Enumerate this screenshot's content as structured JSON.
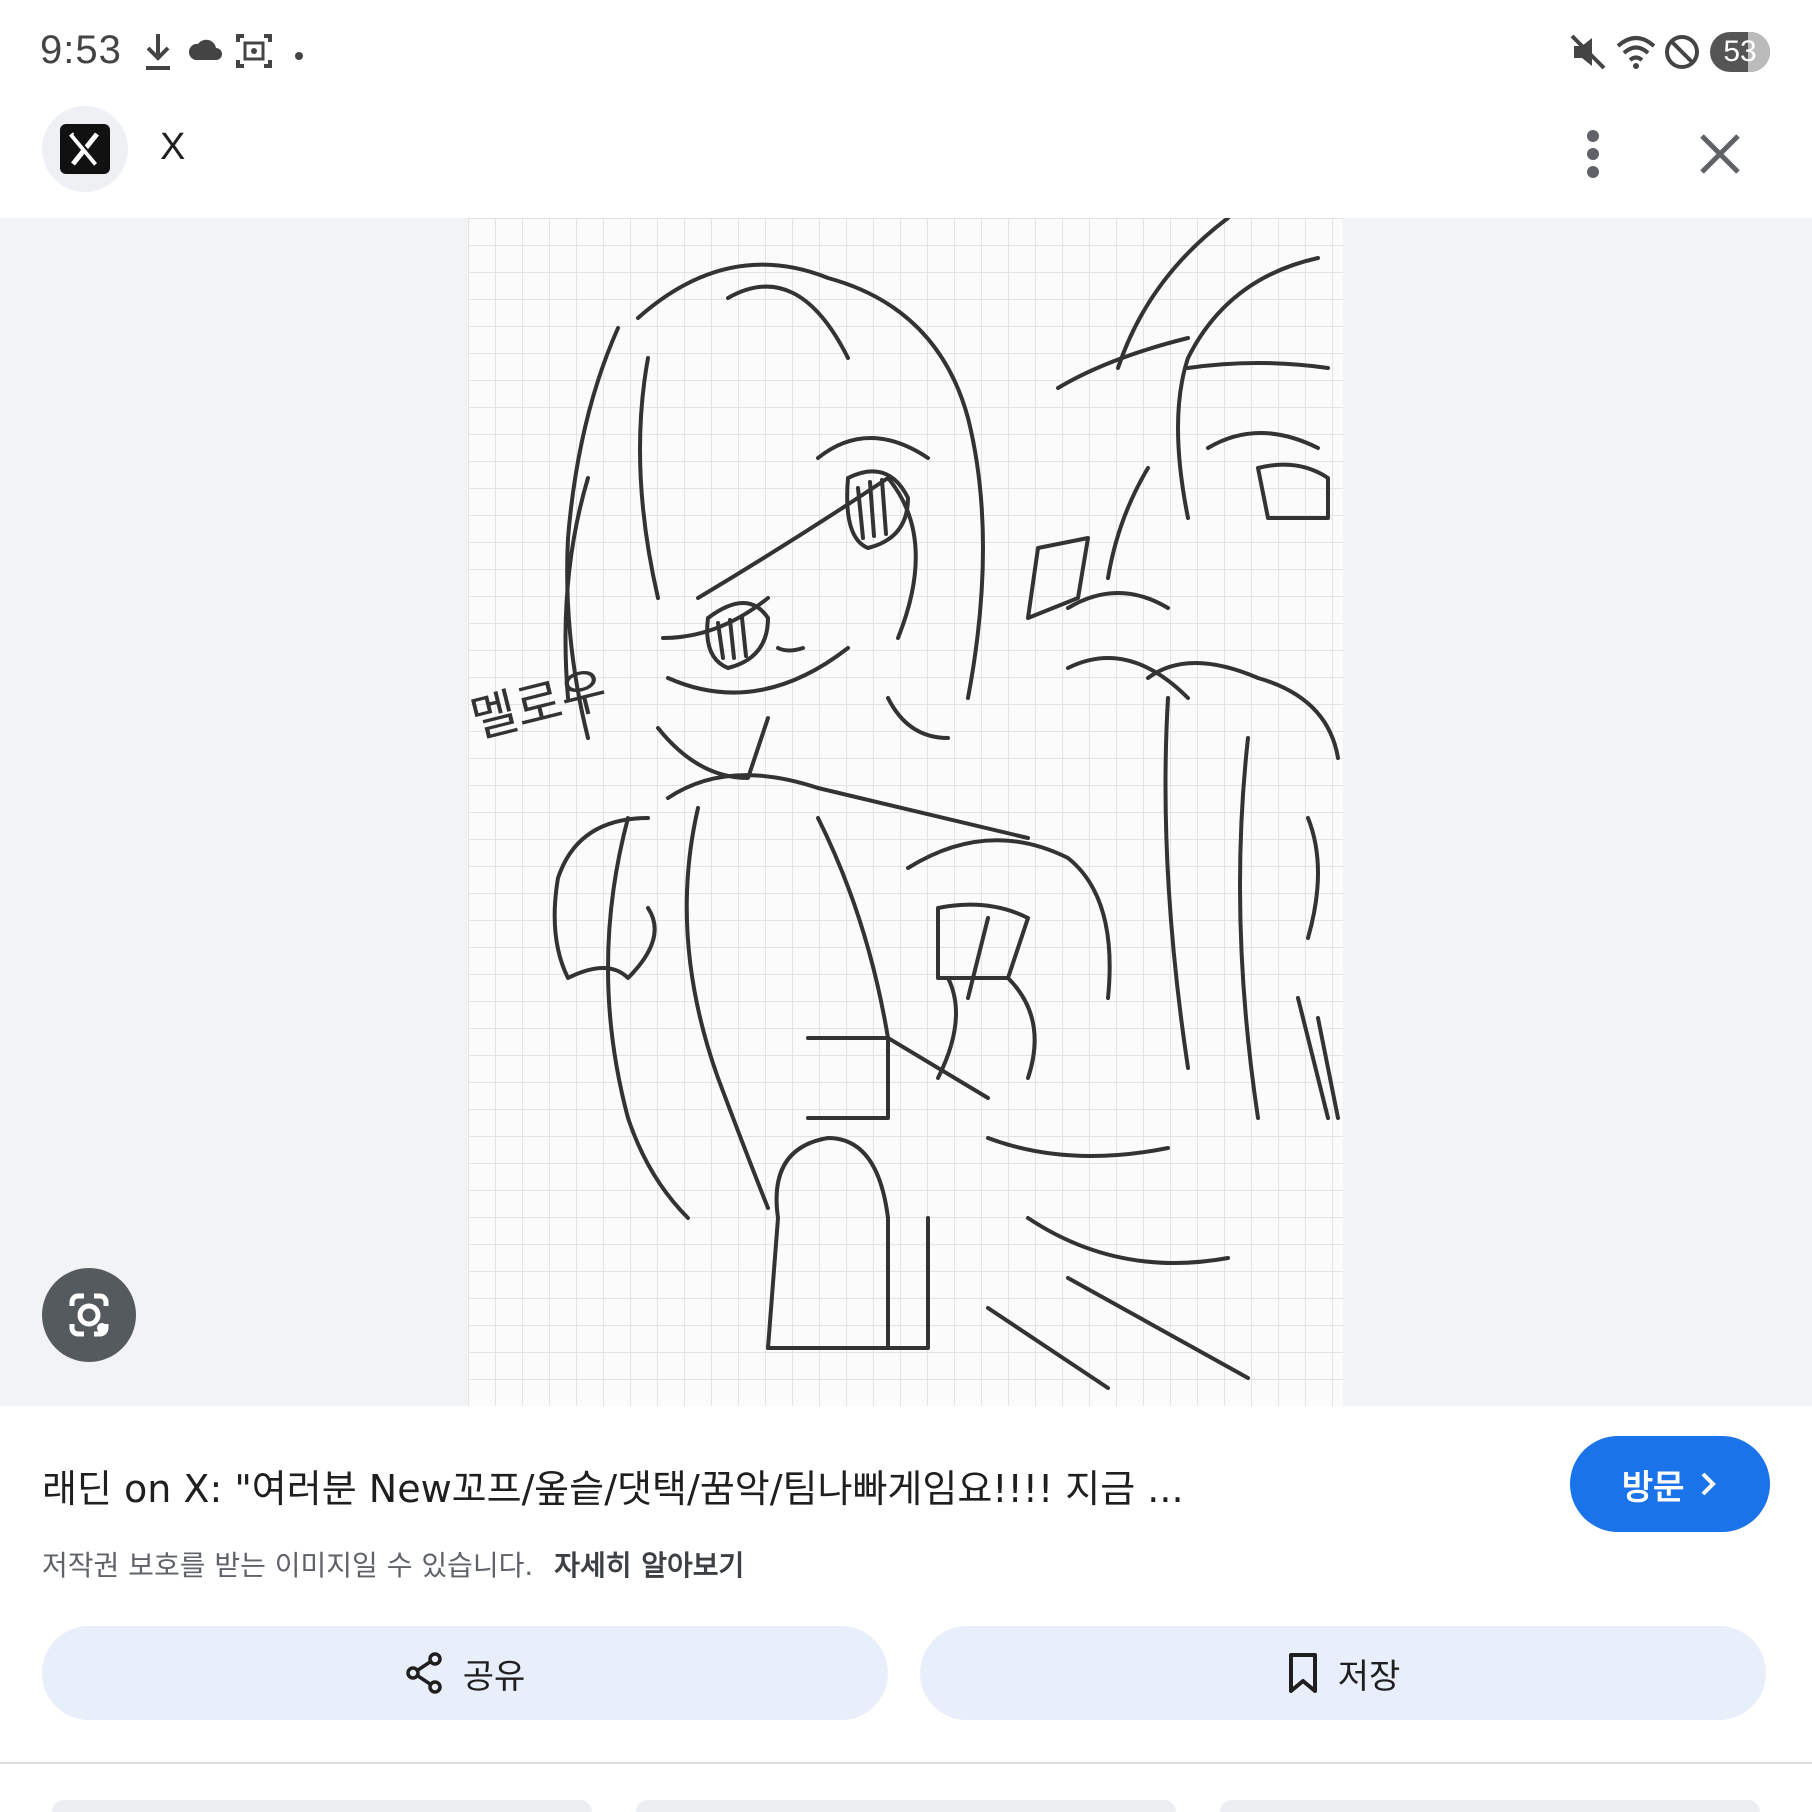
{
  "status_bar": {
    "time": "9:53",
    "left_icons": [
      "download-icon",
      "cloud-icon",
      "screenshot-icon",
      "dot-icon"
    ],
    "right_icons": [
      "mute-icon",
      "wifi-icon",
      "do-not-disturb-icon"
    ],
    "battery": "53"
  },
  "header": {
    "site_name": "X",
    "site_icon": "x-logo-icon",
    "more_icon": "more-vert-icon",
    "close_icon": "close-icon"
  },
  "image": {
    "signature_text": "멜로우",
    "lens_icon": "google-lens-icon"
  },
  "result": {
    "title": "래딘 on X: \"여러분 New꼬프/옾슽/댓택/꿈악/팀나빠게임요!!!! 지금 ...",
    "visit_label": "방문",
    "copyright_text": "저작권 보호를 받는 이미지일 수 있습니다.",
    "learn_more": "자세히 알아보기"
  },
  "actions": {
    "share_label": "공유",
    "save_label": "저장"
  },
  "colors": {
    "accent": "#1a73e8",
    "button_bg": "#e8eefa",
    "image_bg": "#f1f3f4"
  }
}
